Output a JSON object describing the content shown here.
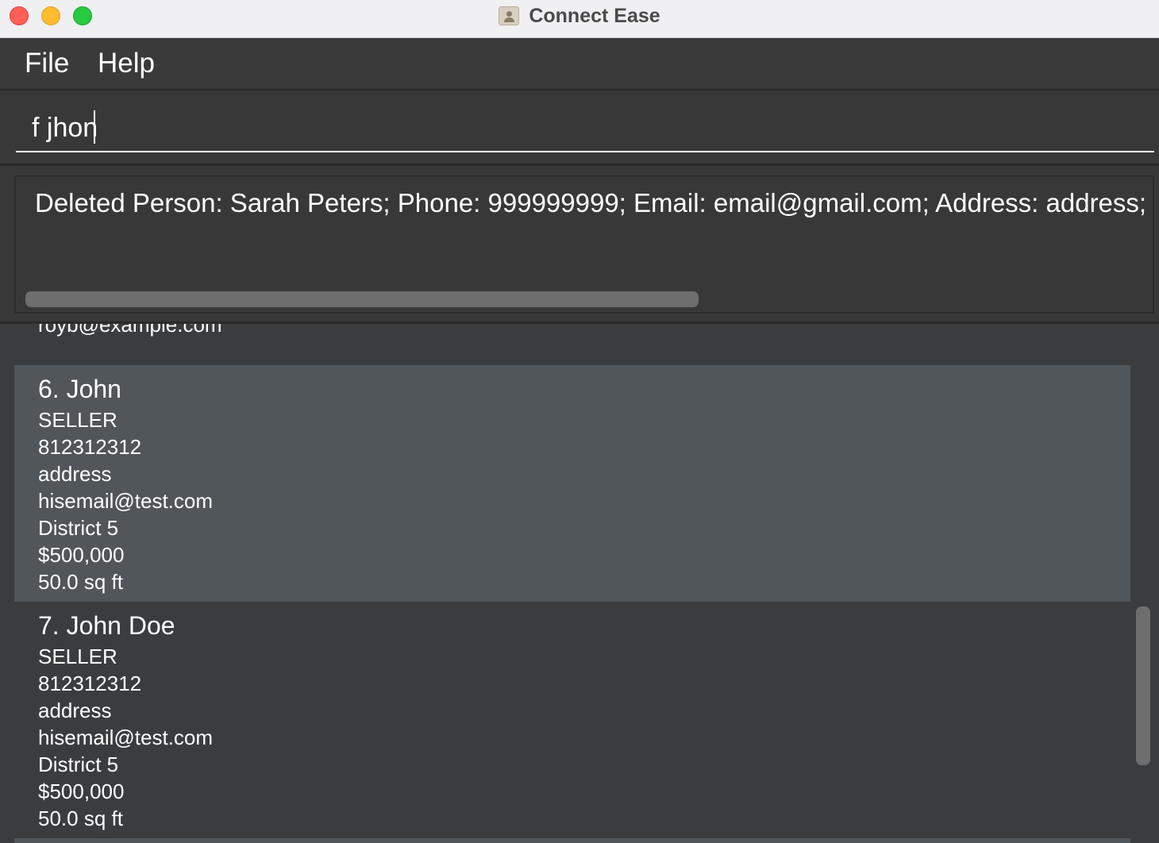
{
  "window": {
    "title": "Connect Ease"
  },
  "menu": {
    "items": [
      "File",
      "Help"
    ]
  },
  "command": {
    "value": "f jhon"
  },
  "result": {
    "text": "Deleted Person: Sarah Peters; Phone: 999999999; Email: email@gmail.com; Address: address; D"
  },
  "list": {
    "partial_text": "royb@example.com",
    "cards": [
      {
        "name": "6. John",
        "fields": [
          "SELLER",
          "812312312",
          "address",
          "hisemail@test.com",
          "District 5",
          "$500,000",
          "50.0 sq ft"
        ]
      },
      {
        "name": "7. John Doe",
        "fields": [
          "SELLER",
          "812312312",
          "address",
          "hisemail@test.com",
          "District 5",
          "$500,000",
          "50.0 sq ft"
        ]
      }
    ]
  }
}
